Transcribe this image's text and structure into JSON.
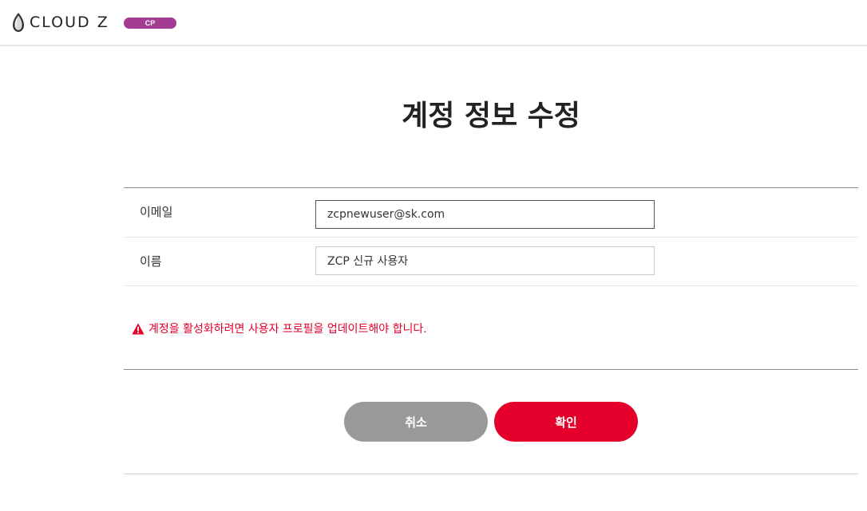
{
  "header": {
    "logo_text": "CLOUD Z",
    "logo_badge": "CP",
    "badge_color": "#a23b91"
  },
  "page": {
    "title": "계정 정보 수정"
  },
  "form": {
    "email": {
      "label": "이메일",
      "value": "zcpnewuser@sk.com"
    },
    "name": {
      "label": "이름",
      "value": "ZCP 신규 사용자"
    }
  },
  "warning": {
    "icon": "warning-triangle-icon",
    "text": "계정을 활성화하려면 사용자 프로필을 업데이트해야 합니다.",
    "color": "#e4002b"
  },
  "buttons": {
    "cancel_label": "취소",
    "confirm_label": "확인",
    "cancel_color": "#999999",
    "confirm_color": "#e4002b"
  }
}
